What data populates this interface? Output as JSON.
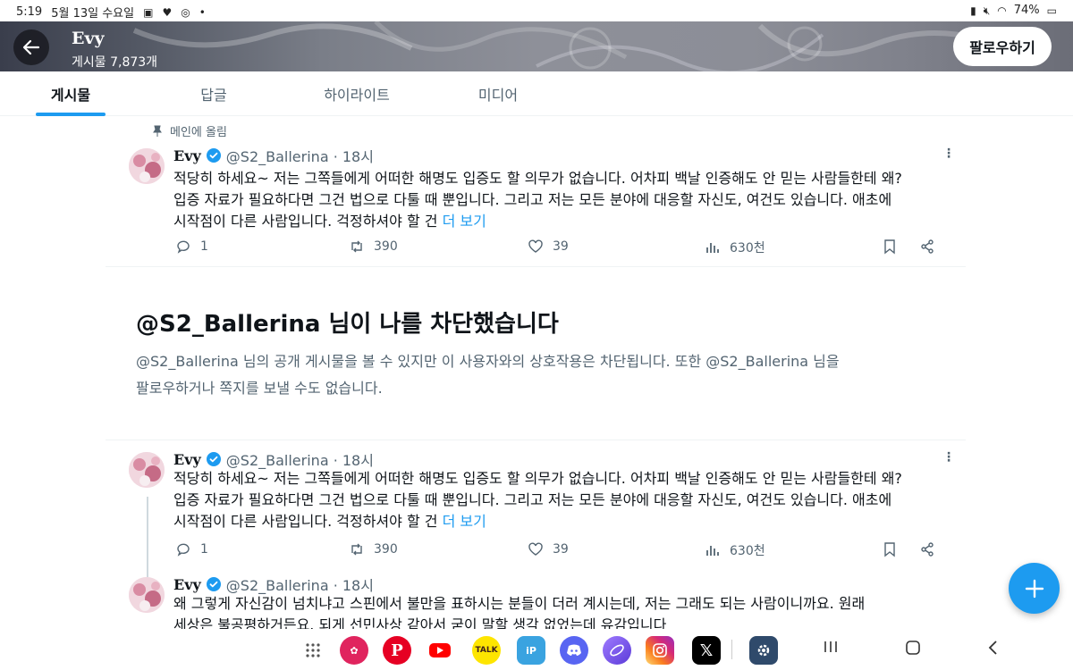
{
  "status_bar": {
    "time": "5:19",
    "date": "5월 13일 수요일",
    "battery": "74%"
  },
  "header": {
    "profile_name": "Evy",
    "post_count": "게시물 7,873개",
    "follow_label": "팔로우하기"
  },
  "tabs": [
    {
      "label": "게시물",
      "active": true
    },
    {
      "label": "답글",
      "active": false
    },
    {
      "label": "하이라이트",
      "active": false
    },
    {
      "label": "미디어",
      "active": false
    }
  ],
  "pinned_label": "메인에 올림",
  "tweets": [
    {
      "name": "Evy",
      "handle": "@S2_Ballerina · 18시",
      "lines": [
        "적당히 하세요~ 저는 그쪽들에게 어떠한 해명도 입증도 할 의무가 없습니다. 어차피 백날 인증해도 안 믿는 사람들한테 왜?",
        "입증 자료가 필요하다면 그건 법으로 다툴 때 뿐입니다. 그리고 저는 모든 분야에 대응할 자신도, 여건도 있습니다. 애초에",
        "시작점이 다른 사람입니다. 걱정하셔야 할 건"
      ],
      "more_link": "더 보기",
      "replies": "1",
      "retweets": "390",
      "likes": "39",
      "views": "630천"
    },
    {
      "name": "Evy",
      "handle": "@S2_Ballerina · 18시",
      "lines": [
        "적당히 하세요~ 저는 그쪽들에게 어떠한 해명도 입증도 할 의무가 없습니다. 어차피 백날 인증해도 안 믿는 사람들한테 왜?",
        "입증 자료가 필요하다면 그건 법으로 다툴 때 뿐입니다. 그리고 저는 모든 분야에 대응할 자신도, 여건도 있습니다. 애초에",
        "시작점이 다른 사람입니다. 걱정하셔야 할 건"
      ],
      "more_link": "더 보기",
      "replies": "1",
      "retweets": "390",
      "likes": "39",
      "views": "630천"
    },
    {
      "name": "Evy",
      "handle": "@S2_Ballerina · 18시",
      "lines": [
        "왜 그렇게 자신감이 넘치냐고 스핀에서 불만을 표하시는 분들이 더러 계시는데, 저는 그래도 되는 사람이니까요. 원래",
        "세상은 불공평하거든요. 되게 선민사상 같아서 굳이 말할 생각 없었는데 유감입니다"
      ]
    }
  ],
  "blocked": {
    "title": "@S2_Ballerina 님이 나를 차단했습니다",
    "desc_line1": "@S2_Ballerina 님의 공개 게시물을 볼 수 있지만 이 사용자와의 상호작용은 차단됩니다. 또한 @S2_Ballerina 님을",
    "desc_line2": "팔로우하거나 쪽지를 보낼 수도 없습니다."
  },
  "dock_apps": [
    {
      "icon": "apps-grid-icon"
    },
    {
      "icon": "daisy-app-icon",
      "color": "#e0245e"
    },
    {
      "icon": "pinterest-icon",
      "color": "#e60023"
    },
    {
      "icon": "youtube-icon",
      "color": "#ff0000"
    },
    {
      "icon": "kakaotalk-icon",
      "color": "#fee500",
      "label": "TALK"
    },
    {
      "icon": "ibis-paint-icon",
      "color": "#3aa3e0"
    },
    {
      "icon": "discord-icon",
      "color": "#5865f2"
    },
    {
      "icon": "browser-icon",
      "color": "#7b5cf5"
    },
    {
      "icon": "instagram-icon",
      "color": "#d62976"
    },
    {
      "icon": "x-icon",
      "color": "#000000"
    },
    {
      "icon": "settings-icon",
      "color": "#2f4a6b"
    }
  ],
  "colors": {
    "accent": "#1d9bf0",
    "text": "#0f1419",
    "muted": "#536471"
  }
}
